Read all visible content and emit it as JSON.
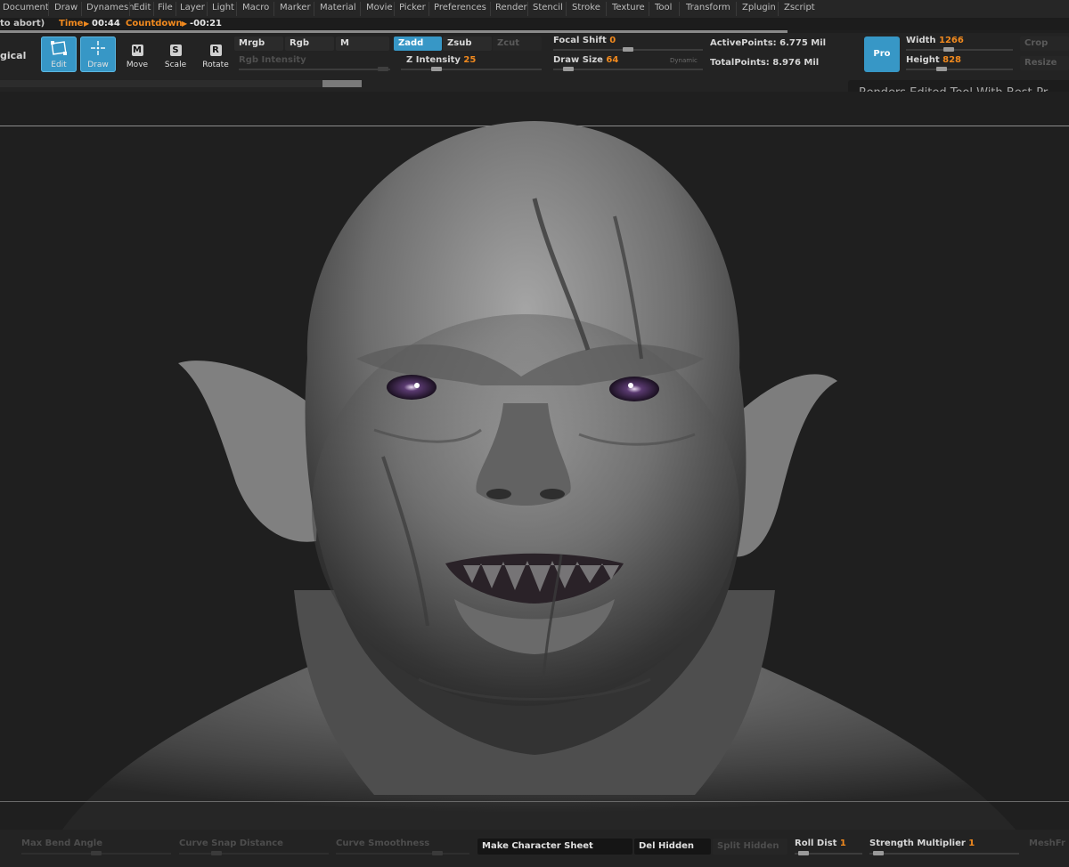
{
  "menu": [
    "Document",
    "Draw",
    "Dynamesh",
    "Edit",
    "File",
    "Layer",
    "Light",
    "Macro",
    "Marker",
    "Material",
    "Movie",
    "Picker",
    "Preferences",
    "Render",
    "Stencil",
    "Stroke",
    "Texture",
    "Tool",
    "Transform",
    "Zplugin",
    "Zscript"
  ],
  "status": {
    "abort_hint": "to abort)",
    "time_label": "Time",
    "time_value": "00:44",
    "countdown_label": "Countdown",
    "countdown_value": "-00:21"
  },
  "shelf": {
    "left_cut_label": "gical",
    "tools": [
      {
        "label": "Edit",
        "key": "",
        "active": true
      },
      {
        "label": "Draw",
        "key": "",
        "active": true
      },
      {
        "label": "Move",
        "key": "M",
        "active": false
      },
      {
        "label": "Scale",
        "key": "S",
        "active": false
      },
      {
        "label": "Rotate",
        "key": "R",
        "active": false
      }
    ],
    "color_modes": {
      "mrgb": "Mrgb",
      "rgb": "Rgb",
      "m": "M"
    },
    "rgb_intensity_label": "Rgb Intensity",
    "z_modes": {
      "zadd": "Zadd",
      "zsub": "Zsub",
      "zcut": "Zcut"
    },
    "z_intensity": {
      "label": "Z Intensity",
      "value": "25",
      "level": 0.25
    },
    "focal_shift": {
      "label": "Focal Shift",
      "value": "0",
      "level": 0.5
    },
    "draw_size": {
      "label": "Draw Size",
      "value": "64",
      "level": 0.1
    },
    "dynamic_label": "Dynamic",
    "active_points": {
      "label": "ActivePoints:",
      "value": "6.775 Mil"
    },
    "total_points": {
      "label": "TotalPoints:",
      "value": "8.976 Mil"
    },
    "pro_label": "Pro",
    "width": {
      "label": "Width",
      "value": "1266"
    },
    "height": {
      "label": "Height",
      "value": "828"
    },
    "crop_label": "Crop",
    "resize_label": "Resize",
    "tooltip": "Renders Edited Tool With Best-Pr"
  },
  "bottom": {
    "max_bend_angle": "Max Bend Angle",
    "curve_snap_distance": "Curve Snap Distance",
    "curve_smoothness": "Curve Smoothness",
    "make_character_sheet": "Make Character Sheet",
    "del_hidden": "Del Hidden",
    "split_hidden": "Split Hidden",
    "roll_dist": {
      "label": "Roll Dist",
      "value": "1"
    },
    "strength_multiplier": {
      "label": "Strength Multiplier",
      "value": "1"
    },
    "meshfrom": "MeshFr"
  },
  "colors": {
    "accent": "#3797c6",
    "value_orange": "#f28a1e",
    "background": "#1e1e1e"
  },
  "icons": [
    "edit-icon",
    "draw-icon",
    "move-icon",
    "scale-icon",
    "rotate-icon"
  ]
}
